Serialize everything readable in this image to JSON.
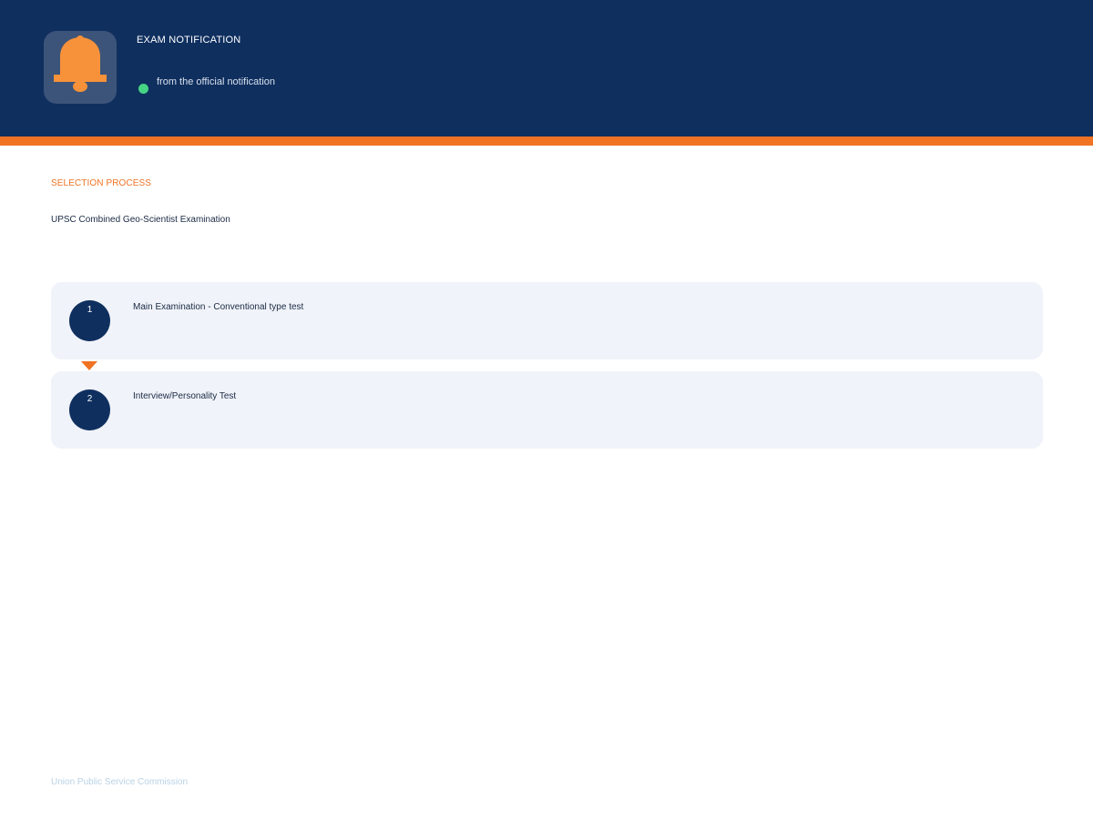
{
  "header": {
    "title": "EXAM NOTIFICATION",
    "status_text": "from the official notification",
    "icon": "bell-icon"
  },
  "section": {
    "label": "SELECTION PROCESS",
    "exam_name": "UPSC Combined Geo-Scientist Examination"
  },
  "steps": [
    {
      "number": "1",
      "label": "Main Examination - Conventional type test"
    },
    {
      "number": "2",
      "label": "Interview/Personality Test"
    }
  ],
  "footer": {
    "text": "Union Public Service Commission"
  },
  "colors": {
    "header_bg": "#0f2f5f",
    "accent": "#f07324",
    "bell": "#f7923a",
    "status_dot": "#45d483",
    "card_bg": "#f0f3f9",
    "footer_text": "#b9d3e6"
  }
}
